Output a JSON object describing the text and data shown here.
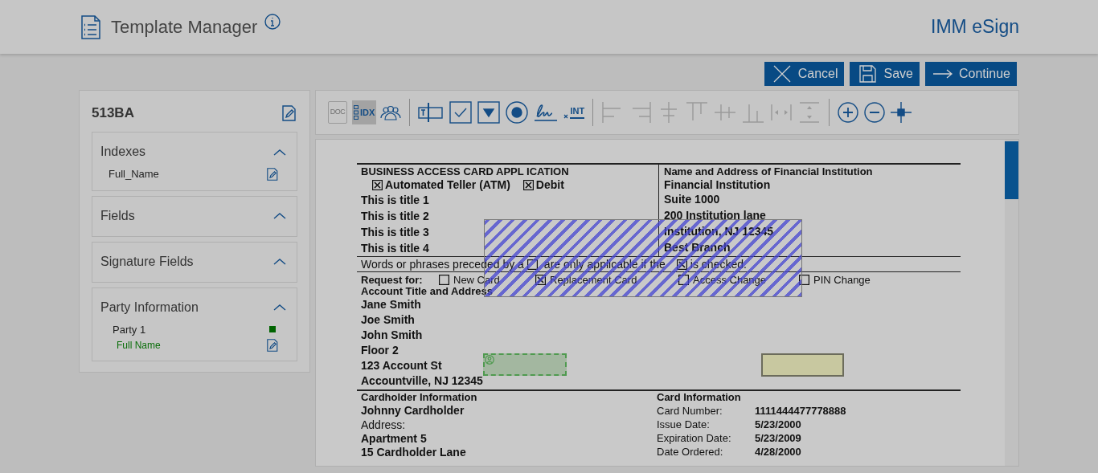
{
  "header": {
    "title": "Template Manager",
    "brand": "IMM eSign"
  },
  "actions": [
    {
      "kind": "cancel",
      "label": "Cancel"
    },
    {
      "kind": "save",
      "label": "Save"
    },
    {
      "kind": "continue",
      "label": "Continue"
    }
  ],
  "sidebar": {
    "title": "513BA",
    "sections": [
      {
        "title": "Indexes",
        "expanded": true,
        "items": [
          {
            "kind": "index",
            "label": "Full_Name"
          }
        ]
      },
      {
        "title": "Fields",
        "expanded": true
      },
      {
        "title": "Signature Fields",
        "expanded": true
      },
      {
        "title": "Party Information",
        "expanded": true,
        "items": [
          {
            "kind": "party",
            "label": "Party 1",
            "color": "#006400"
          },
          {
            "kind": "party_field",
            "label": "Full Name"
          }
        ]
      }
    ]
  },
  "toolbar": {
    "groups": [
      [
        {
          "kind": "doc",
          "label": "DOC",
          "disabled": true,
          "selected": false
        },
        {
          "kind": "index",
          "label": "IDX",
          "disabled": false,
          "selected": true
        },
        {
          "kind": "parties",
          "disabled": false,
          "selected": false
        }
      ],
      [
        {
          "kind": "text",
          "disabled": false,
          "selected": false
        },
        {
          "kind": "checkbox",
          "disabled": false,
          "selected": false
        },
        {
          "kind": "dropdown",
          "disabled": false,
          "selected": false
        },
        {
          "kind": "radio",
          "disabled": false,
          "selected": false
        },
        {
          "kind": "signature",
          "disabled": false,
          "selected": false
        },
        {
          "kind": "initials",
          "label": "INT",
          "disabled": false,
          "selected": false
        }
      ],
      [
        {
          "kind": "align_left",
          "disabled": true,
          "selected": false
        },
        {
          "kind": "align_right",
          "disabled": true,
          "selected": false
        },
        {
          "kind": "align_center",
          "disabled": true,
          "selected": false
        },
        {
          "kind": "align_top",
          "disabled": true,
          "selected": false
        },
        {
          "kind": "align_middle",
          "disabled": true,
          "selected": false
        },
        {
          "kind": "align_bottom",
          "disabled": true,
          "selected": false
        },
        {
          "kind": "space_h",
          "disabled": true,
          "selected": false
        },
        {
          "kind": "space_v",
          "disabled": true,
          "selected": false
        }
      ],
      [
        {
          "kind": "zoom_in",
          "disabled": false,
          "selected": false
        },
        {
          "kind": "zoom_out",
          "disabled": false,
          "selected": false
        },
        {
          "kind": "crosshair",
          "disabled": false,
          "selected": false
        }
      ]
    ]
  },
  "document": {
    "title": "BUSINESS ACCESS CARD APPL ICATION",
    "options": [
      {
        "label": "Automated Teller (ATM)",
        "checked": true
      },
      {
        "label": "Debit",
        "checked": true
      }
    ],
    "titles": [
      "This is title 1",
      "This is title 2",
      "This is title 3",
      "This is title 4"
    ],
    "institution": {
      "heading": "Name and Address of Financial Institution",
      "lines": [
        "Financial Institution",
        "Suite 1000",
        "200 Institution lane",
        "Institution, NJ 12345",
        "Best Branch"
      ]
    },
    "note": {
      "text_1": "Words or phrases preceded by a",
      "box_1_checked": false,
      "text_2": "are only applicable if the",
      "box_2_checked": true,
      "text_3": "is checked."
    },
    "request": {
      "label": "Request for:",
      "options": [
        {
          "label": "New Card",
          "checked": false
        },
        {
          "label": "Replacement Card",
          "checked": true
        },
        {
          "label": "Access Change",
          "checked": false
        },
        {
          "label": "PIN Change",
          "checked": false
        }
      ]
    },
    "account": {
      "heading": "Account Title and Address",
      "lines": [
        "Jane Smith",
        "Joe Smith",
        "John Smith",
        "Floor 2",
        "123 Account St",
        "Accountville, NJ 12345"
      ]
    },
    "cardholder": {
      "heading": "Cardholder Information",
      "name": "Johnny Cardholder",
      "address_label": "Address:",
      "lines": [
        "Apartment 5",
        "15 Cardholder Lane"
      ]
    },
    "card_info": {
      "heading": "Card Information",
      "rows": [
        {
          "label": "Card Number:",
          "value": "1111444477778888"
        },
        {
          "label": "Issue Date:",
          "value": "5/23/2000"
        },
        {
          "label": "Expiration Date:",
          "value": "5/23/2009"
        },
        {
          "label": "Date Ordered:",
          "value": "4/28/2000"
        }
      ]
    }
  }
}
